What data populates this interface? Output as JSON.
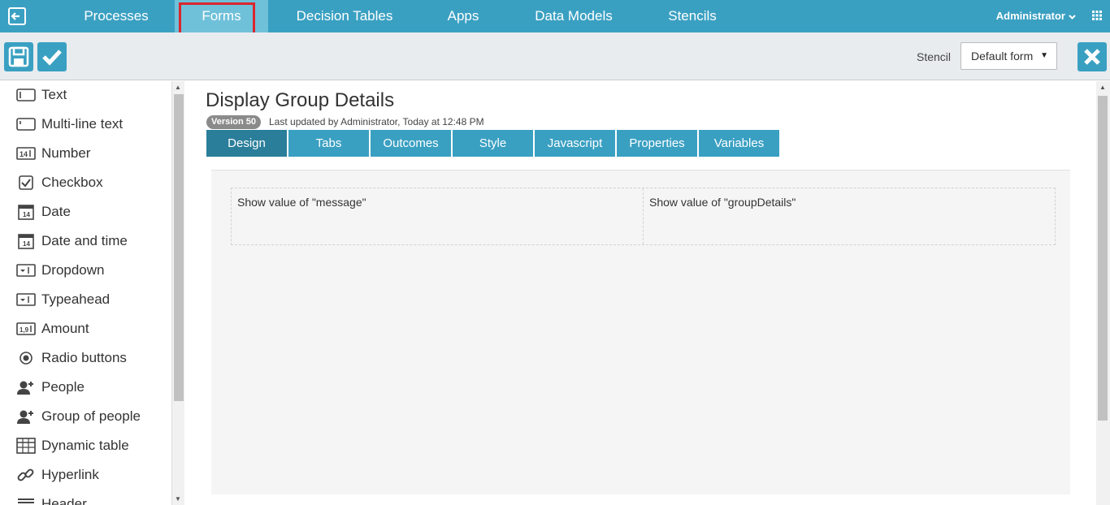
{
  "topnav": {
    "items": [
      {
        "label": "Processes"
      },
      {
        "label": "Forms"
      },
      {
        "label": "Decision Tables"
      },
      {
        "label": "Apps"
      },
      {
        "label": "Data Models"
      },
      {
        "label": "Stencils"
      }
    ],
    "user": "Administrator"
  },
  "toolbar": {
    "stencil_label": "Stencil",
    "stencil_value": "Default form"
  },
  "palette": {
    "items": [
      {
        "label": "Text",
        "icon": "text-field-icon"
      },
      {
        "label": "Multi-line text",
        "icon": "multiline-text-icon"
      },
      {
        "label": "Number",
        "icon": "number-icon"
      },
      {
        "label": "Checkbox",
        "icon": "checkbox-icon"
      },
      {
        "label": "Date",
        "icon": "date-icon"
      },
      {
        "label": "Date and time",
        "icon": "date-time-icon"
      },
      {
        "label": "Dropdown",
        "icon": "dropdown-icon"
      },
      {
        "label": "Typeahead",
        "icon": "typeahead-icon"
      },
      {
        "label": "Amount",
        "icon": "amount-icon"
      },
      {
        "label": "Radio buttons",
        "icon": "radio-icon"
      },
      {
        "label": "People",
        "icon": "people-icon"
      },
      {
        "label": "Group of people",
        "icon": "group-icon"
      },
      {
        "label": "Dynamic table",
        "icon": "table-icon"
      },
      {
        "label": "Hyperlink",
        "icon": "link-icon"
      },
      {
        "label": "Header",
        "icon": "header-icon"
      }
    ]
  },
  "form": {
    "title": "Display Group Details",
    "version": "Version 50",
    "last_updated": "Last updated by Administrator, Today at 12:48 PM",
    "tabs": [
      {
        "label": "Design"
      },
      {
        "label": "Tabs"
      },
      {
        "label": "Outcomes"
      },
      {
        "label": "Style"
      },
      {
        "label": "Javascript"
      },
      {
        "label": "Properties"
      },
      {
        "label": "Variables"
      }
    ],
    "fields": [
      {
        "label": "Show value of \"message\""
      },
      {
        "label": "Show value of \"groupDetails\""
      }
    ]
  },
  "colors": {
    "accent": "#3aa0c2",
    "active_tab": "#2a7e9a",
    "highlight": "#d9272e"
  }
}
